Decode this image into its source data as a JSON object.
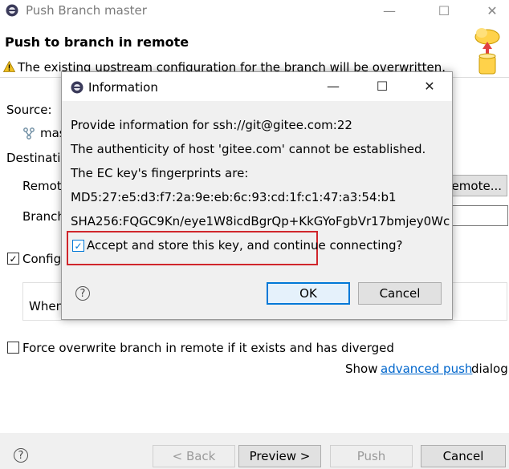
{
  "window": {
    "title": "Push Branch master",
    "controls": {
      "minimize": "—",
      "maximize": "☐",
      "close": "✕"
    }
  },
  "banner": {
    "heading": "Push to branch in remote",
    "warning": "The existing upstream configuration for the branch will be overwritten."
  },
  "form": {
    "source_label": "Source:",
    "source_branch": "master",
    "destination_label": "Destination:",
    "remote_label": "Remote:",
    "remote_button": "Remote...",
    "branch_label": "Branch:",
    "configure_checkbox": "Configure upstream for push and pull",
    "configure_checked": true,
    "when_label": "When pulling:",
    "force_checkbox": "Force overwrite branch in remote if it exists and has diverged",
    "force_checked": false,
    "show_prefix": "Show",
    "show_link": "advanced push",
    "show_suffix": "dialog"
  },
  "footer": {
    "back": "< Back",
    "preview": "Preview >",
    "push": "Push",
    "cancel": "Cancel"
  },
  "dialog": {
    "title": "Information",
    "controls": {
      "minimize": "—",
      "maximize": "☐",
      "close": "✕"
    },
    "line1": "Provide information for ssh://git@gitee.com:22",
    "line2": "The authenticity of host 'gitee.com' cannot be established.",
    "line3": "The EC key's fingerprints are:",
    "line4": "MD5:27:e5:d3:f7:2a:9e:eb:6c:93:cd:1f:c1:47:a3:54:b1",
    "line5": "SHA256:FQGC9Kn/eye1W8icdBgrQp+KkGYoFgbVr17bmjey0Wc",
    "accept_checkbox": "Accept and store this key, and continue connecting?",
    "accept_checked": true,
    "ok": "OK",
    "cancel": "Cancel"
  },
  "colors": {
    "accent": "#0078d7",
    "highlight_box": "#d0262c",
    "link": "#0066cc"
  }
}
